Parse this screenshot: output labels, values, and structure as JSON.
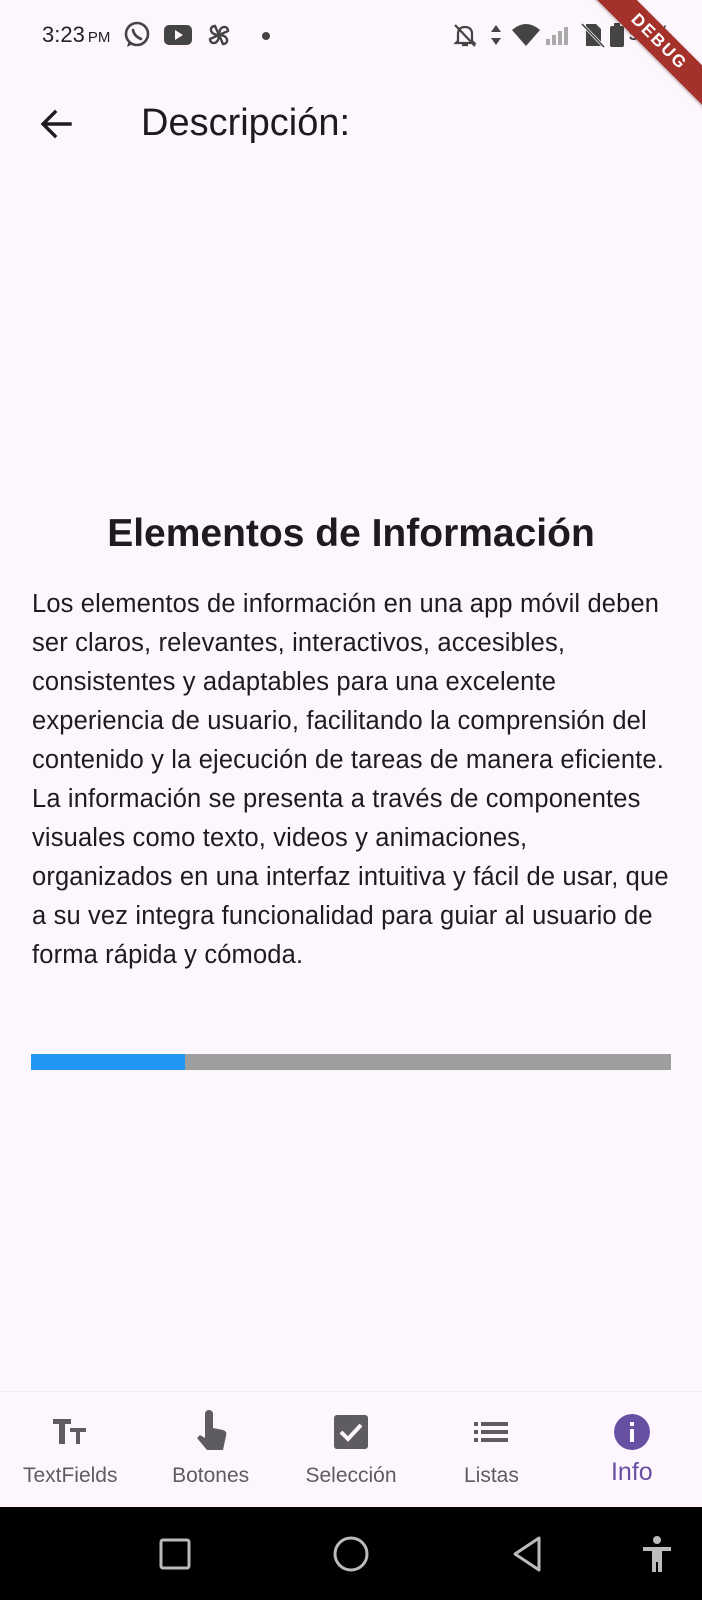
{
  "status_bar": {
    "time": "3:23",
    "ampm": "PM",
    "battery": "98%",
    "icons": [
      "whatsapp-icon",
      "youtube-icon",
      "pinwheel-icon",
      "notifications-off-icon",
      "data-arrows-icon",
      "wifi-icon",
      "signal-icon",
      "no-sim-icon",
      "battery-icon"
    ]
  },
  "debug_banner": "DEBUG",
  "app_bar": {
    "title": "Descripción:",
    "back_icon": "arrow-back-icon"
  },
  "content": {
    "title": "Elementos de Información",
    "body": "Los elementos de información en una app móvil deben ser claros, relevantes, interactivos, accesibles, consistentes y adaptables para una excelente experiencia de usuario, facilitando la comprensión del contenido y la ejecución de tareas de manera eficiente. La información se presenta a través de componentes visuales como texto, videos y animaciones, organizados en una interfaz intuitiva y fácil de usar, que a su vez integra funcionalidad para guiar al usuario de forma rápida y cómoda.",
    "progress": 0.24,
    "progress_color": "#2196f3",
    "track_color": "#9e9e9e"
  },
  "bottom_nav": {
    "active_color": "#6750a4",
    "items": [
      {
        "label": "TextFields",
        "icon": "text-fields-icon"
      },
      {
        "label": "Botones",
        "icon": "touch-icon"
      },
      {
        "label": "Selección",
        "icon": "checkbox-icon"
      },
      {
        "label": "Listas",
        "icon": "list-icon"
      },
      {
        "label": "Info",
        "icon": "info-icon"
      }
    ]
  },
  "system_nav": [
    "recents-icon",
    "home-icon",
    "back-icon",
    "accessibility-icon"
  ]
}
